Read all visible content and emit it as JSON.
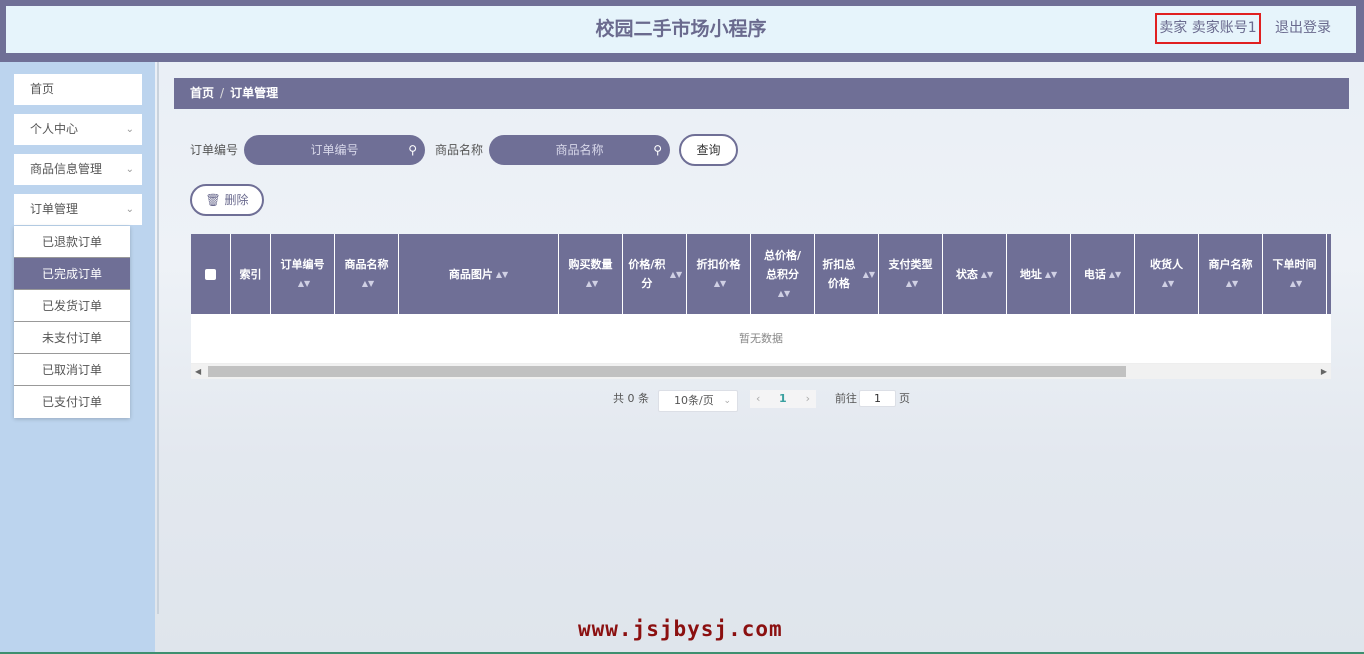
{
  "header": {
    "title": "校园二手市场小程序",
    "user": "卖家 卖家账号1",
    "logout": "退出登录"
  },
  "sidebar": {
    "items": [
      {
        "label": "首页",
        "has_chevron": false
      },
      {
        "label": "个人中心",
        "has_chevron": true
      },
      {
        "label": "商品信息管理",
        "has_chevron": true
      },
      {
        "label": "订单管理",
        "has_chevron": true
      }
    ],
    "submenu": [
      {
        "label": "已退款订单",
        "active": false
      },
      {
        "label": "已完成订单",
        "active": true
      },
      {
        "label": "已发货订单",
        "active": false
      },
      {
        "label": "未支付订单",
        "active": false
      },
      {
        "label": "已取消订单",
        "active": false
      },
      {
        "label": "已支付订单",
        "active": false
      }
    ]
  },
  "breadcrumb": {
    "home": "首页",
    "separator": "/",
    "current": "订单管理"
  },
  "search": {
    "order_no_label": "订单编号",
    "order_no_placeholder": "订单编号",
    "product_name_label": "商品名称",
    "product_name_placeholder": "商品名称",
    "query_button": "查询"
  },
  "actions": {
    "delete_button": "删除"
  },
  "table": {
    "columns": [
      {
        "label": "索引",
        "sortable": false
      },
      {
        "label": "订单编号",
        "sortable": true
      },
      {
        "label": "商品名称",
        "sortable": true
      },
      {
        "label": "商品图片",
        "sortable": true
      },
      {
        "label": "购买数量",
        "sortable": true
      },
      {
        "label": "价格/积分",
        "sortable": true
      },
      {
        "label": "折扣价格",
        "sortable": true
      },
      {
        "label": "总价格/总积分",
        "sortable": true
      },
      {
        "label": "折扣总价格",
        "sortable": true
      },
      {
        "label": "支付类型",
        "sortable": true
      },
      {
        "label": "状态",
        "sortable": true
      },
      {
        "label": "地址",
        "sortable": true
      },
      {
        "label": "电话",
        "sortable": true
      },
      {
        "label": "收货人",
        "sortable": true
      },
      {
        "label": "商户名称",
        "sortable": true
      },
      {
        "label": "下单时间",
        "sortable": true
      }
    ],
    "empty_text": "暂无数据"
  },
  "pagination": {
    "total": "共 0 条",
    "page_size": "10条/页",
    "current_page": "1",
    "goto_label": "前往",
    "goto_value": "1",
    "goto_unit": "页"
  },
  "watermark": "www.jsjbysj.com",
  "colors": {
    "primary": "#6f6f96",
    "sidebar": "#bcd4ee",
    "header_bg": "#e6f4fb",
    "highlight": "#e02020"
  }
}
